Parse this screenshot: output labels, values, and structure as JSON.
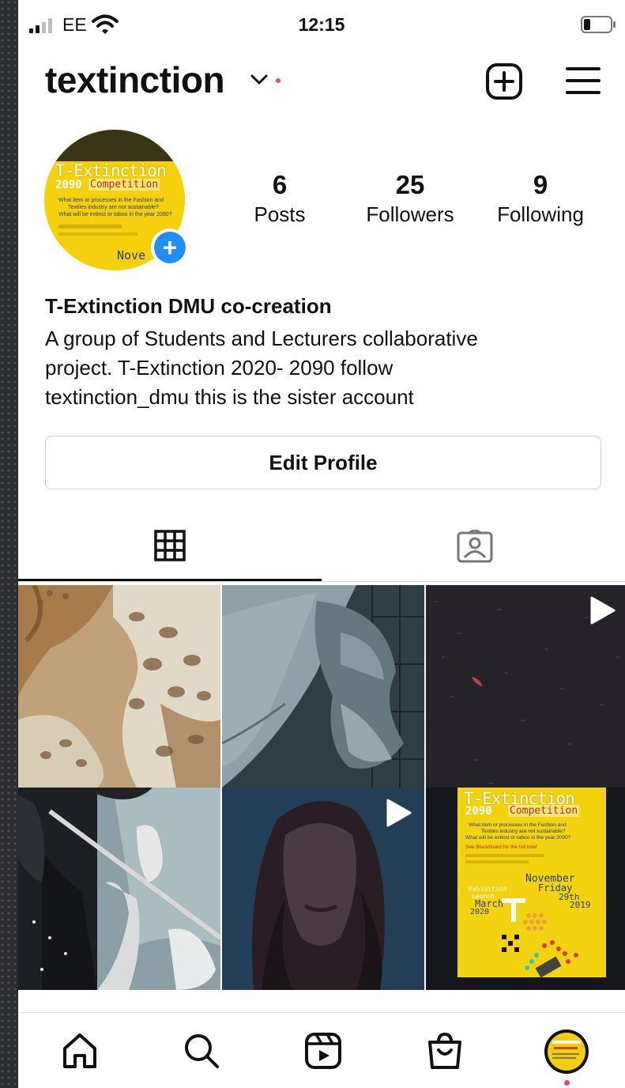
{
  "status_bar": {
    "carrier": "EE",
    "time": "12:15",
    "signal_bars": 4,
    "signal_bars_active": 2,
    "battery_level": 0.2
  },
  "header": {
    "username": "textinction",
    "icons": [
      "chevron-down-icon",
      "new-post-icon",
      "menu-icon"
    ]
  },
  "profile": {
    "avatar_poster": {
      "title": "T-Extinction",
      "year": "2090",
      "subtitle": "Competition",
      "line1": "What item or processes in the Fashion and",
      "line2": "Textiles industry are not sustainable?",
      "line3": "What will be extinct or taboo in the year 2090?",
      "corner_text": "Nove"
    },
    "stats": [
      {
        "value": "6",
        "label": "Posts"
      },
      {
        "value": "25",
        "label": "Followers"
      },
      {
        "value": "9",
        "label": "Following"
      }
    ],
    "display_name": "T-Extinction DMU co-creation",
    "bio_lines": [
      "A group of Students and Lecturers collaborative",
      "project. T-Extinction 2020- 2090 follow",
      "textinction_dmu this is the sister account"
    ],
    "edit_button": "Edit Profile"
  },
  "tabs": [
    {
      "icon": "grid-icon",
      "active": true
    },
    {
      "icon": "tagged-icon",
      "active": false
    }
  ],
  "posts": [
    {
      "subject": "burnt-lace-fabric",
      "video": false
    },
    {
      "subject": "denim-knot",
      "video": false
    },
    {
      "subject": "dark-soil",
      "video": true
    },
    {
      "subject": "knotted-clothes-tent",
      "video": false
    },
    {
      "subject": "dark-face",
      "video": true
    },
    {
      "subject": "competition-poster",
      "video": false,
      "poster": {
        "title": "T-Extinction",
        "year": "2090",
        "subtitle": "Competition",
        "line1": "What item or processes in the Fashion and",
        "line2": "Textiles industry are not sustainable?",
        "line3": "What will be extinct or taboo in the year 2090?",
        "line4": "See Blackboard for the full brief",
        "date_label": "November",
        "day_label": "Friday",
        "date_num": "29th",
        "year_num": "2019",
        "launch1": "Exhibition",
        "launch2": "Launch",
        "month2": "March",
        "year2": "2020"
      }
    }
  ],
  "bottom_nav": [
    "home-icon",
    "search-icon",
    "reels-icon",
    "shop-icon",
    "profile-avatar"
  ],
  "colors": {
    "accent_blue": "#1f8ff5",
    "notification_red": "#ed4956",
    "poster_yellow": "#f5d20e"
  }
}
